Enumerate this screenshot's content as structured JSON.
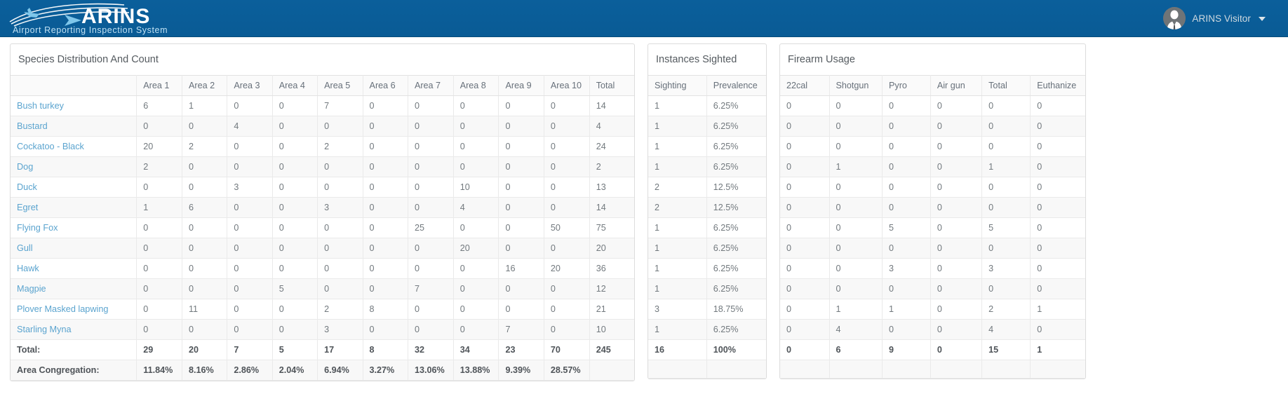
{
  "header": {
    "logo_title": "ARINS",
    "logo_subtitle": "Airport Reporting Inspection System",
    "user_name": "ARINS Visitor"
  },
  "panels": {
    "species": {
      "title": "Species Distribution And Count",
      "columns": [
        "",
        "Area 1",
        "Area 2",
        "Area 3",
        "Area 4",
        "Area 5",
        "Area 6",
        "Area 7",
        "Area 8",
        "Area 9",
        "Area 10",
        "Total"
      ],
      "rows": [
        {
          "species": "Bush turkey",
          "values": [
            "6",
            "1",
            "0",
            "0",
            "7",
            "0",
            "0",
            "0",
            "0",
            "0",
            "14"
          ]
        },
        {
          "species": "Bustard",
          "values": [
            "0",
            "0",
            "4",
            "0",
            "0",
            "0",
            "0",
            "0",
            "0",
            "0",
            "4"
          ]
        },
        {
          "species": "Cockatoo - Black",
          "values": [
            "20",
            "2",
            "0",
            "0",
            "2",
            "0",
            "0",
            "0",
            "0",
            "0",
            "24"
          ]
        },
        {
          "species": "Dog",
          "values": [
            "2",
            "0",
            "0",
            "0",
            "0",
            "0",
            "0",
            "0",
            "0",
            "0",
            "2"
          ]
        },
        {
          "species": "Duck",
          "values": [
            "0",
            "0",
            "3",
            "0",
            "0",
            "0",
            "0",
            "10",
            "0",
            "0",
            "13"
          ]
        },
        {
          "species": "Egret",
          "values": [
            "1",
            "6",
            "0",
            "0",
            "3",
            "0",
            "0",
            "4",
            "0",
            "0",
            "14"
          ]
        },
        {
          "species": "Flying Fox",
          "values": [
            "0",
            "0",
            "0",
            "0",
            "0",
            "0",
            "25",
            "0",
            "0",
            "50",
            "75"
          ]
        },
        {
          "species": "Gull",
          "values": [
            "0",
            "0",
            "0",
            "0",
            "0",
            "0",
            "0",
            "20",
            "0",
            "0",
            "20"
          ]
        },
        {
          "species": "Hawk",
          "values": [
            "0",
            "0",
            "0",
            "0",
            "0",
            "0",
            "0",
            "0",
            "16",
            "20",
            "36"
          ]
        },
        {
          "species": "Magpie",
          "values": [
            "0",
            "0",
            "0",
            "5",
            "0",
            "0",
            "7",
            "0",
            "0",
            "0",
            "12"
          ]
        },
        {
          "species": "Plover Masked lapwing",
          "values": [
            "0",
            "11",
            "0",
            "0",
            "2",
            "8",
            "0",
            "0",
            "0",
            "0",
            "21"
          ]
        },
        {
          "species": "Starling Myna",
          "values": [
            "0",
            "0",
            "0",
            "0",
            "3",
            "0",
            "0",
            "0",
            "7",
            "0",
            "10"
          ]
        }
      ],
      "total_label": "Total:",
      "total_values": [
        "29",
        "20",
        "7",
        "5",
        "17",
        "8",
        "32",
        "34",
        "23",
        "70",
        "245"
      ],
      "congregation_label": "Area Congregation:",
      "congregation_values": [
        "11.84%",
        "8.16%",
        "2.86%",
        "2.04%",
        "6.94%",
        "3.27%",
        "13.06%",
        "13.88%",
        "9.39%",
        "28.57%",
        ""
      ]
    },
    "instances": {
      "title": "Instances Sighted",
      "columns": [
        "Sighting",
        "Prevalence"
      ],
      "rows": [
        [
          "1",
          "6.25%"
        ],
        [
          "1",
          "6.25%"
        ],
        [
          "1",
          "6.25%"
        ],
        [
          "1",
          "6.25%"
        ],
        [
          "2",
          "12.5%"
        ],
        [
          "2",
          "12.5%"
        ],
        [
          "1",
          "6.25%"
        ],
        [
          "1",
          "6.25%"
        ],
        [
          "1",
          "6.25%"
        ],
        [
          "1",
          "6.25%"
        ],
        [
          "3",
          "18.75%"
        ],
        [
          "1",
          "6.25%"
        ]
      ],
      "total_row": [
        "16",
        "100%"
      ],
      "blank_row": [
        "",
        ""
      ]
    },
    "firearm": {
      "title": "Firearm Usage",
      "columns": [
        "22cal",
        "Shotgun",
        "Pyro",
        "Air gun",
        "Total",
        "Euthanize"
      ],
      "rows": [
        [
          "0",
          "0",
          "0",
          "0",
          "0",
          "0"
        ],
        [
          "0",
          "0",
          "0",
          "0",
          "0",
          "0"
        ],
        [
          "0",
          "0",
          "0",
          "0",
          "0",
          "0"
        ],
        [
          "0",
          "1",
          "0",
          "0",
          "1",
          "0"
        ],
        [
          "0",
          "0",
          "0",
          "0",
          "0",
          "0"
        ],
        [
          "0",
          "0",
          "0",
          "0",
          "0",
          "0"
        ],
        [
          "0",
          "0",
          "5",
          "0",
          "5",
          "0"
        ],
        [
          "0",
          "0",
          "0",
          "0",
          "0",
          "0"
        ],
        [
          "0",
          "0",
          "3",
          "0",
          "3",
          "0"
        ],
        [
          "0",
          "0",
          "0",
          "0",
          "0",
          "0"
        ],
        [
          "0",
          "1",
          "1",
          "0",
          "2",
          "1"
        ],
        [
          "0",
          "4",
          "0",
          "0",
          "4",
          "0"
        ]
      ],
      "total_row": [
        "0",
        "6",
        "9",
        "0",
        "15",
        "1"
      ],
      "blank_row": [
        "",
        "",
        "",
        "",
        "",
        ""
      ]
    }
  },
  "colors": {
    "header_blue": "#0a5e99",
    "link_blue": "#5ba4cf",
    "text_grey": "#72797e"
  }
}
